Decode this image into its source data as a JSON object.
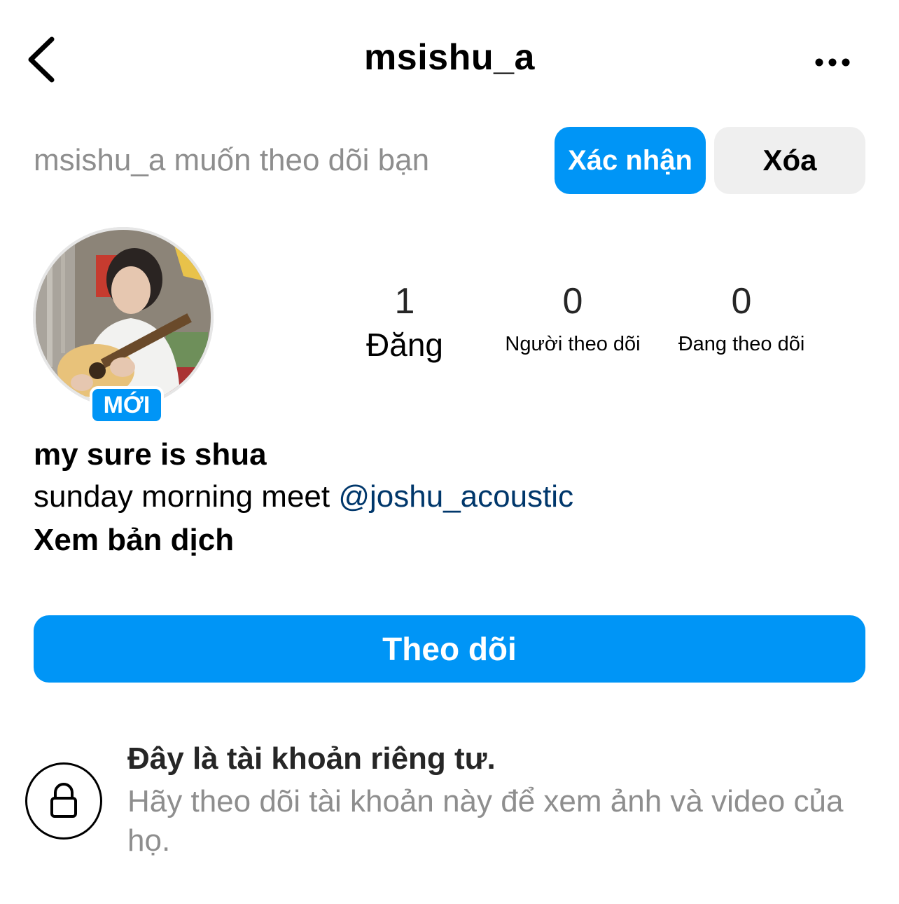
{
  "header": {
    "username": "msishu_a",
    "back_icon": "chevron-left-icon",
    "more_icon": "more-horizontal-icon"
  },
  "request": {
    "text": "msishu_a muốn theo dõi bạn",
    "confirm_label": "Xác nhận",
    "delete_label": "Xóa"
  },
  "profile": {
    "new_badge": "MỚI",
    "stats": [
      {
        "value": "1",
        "label": "Đăng"
      },
      {
        "value": "0",
        "label": "Người theo dõi"
      },
      {
        "value": "0",
        "label": "Đang theo dõi"
      }
    ],
    "display_name": "my sure is shua",
    "bio_text": "sunday morning meet ",
    "bio_mention": "@joshu_acoustic",
    "translate_label": "Xem bản dịch"
  },
  "follow_label": "Theo dõi",
  "private": {
    "icon": "lock-icon",
    "title": "Đây là tài khoản riêng tư.",
    "description": "Hãy theo dõi tài khoản này để xem ảnh và video của họ."
  },
  "colors": {
    "accent": "#0095f6",
    "mention": "#00376b",
    "secondary_text": "#8e8e8e",
    "button_gray": "#efefef"
  }
}
